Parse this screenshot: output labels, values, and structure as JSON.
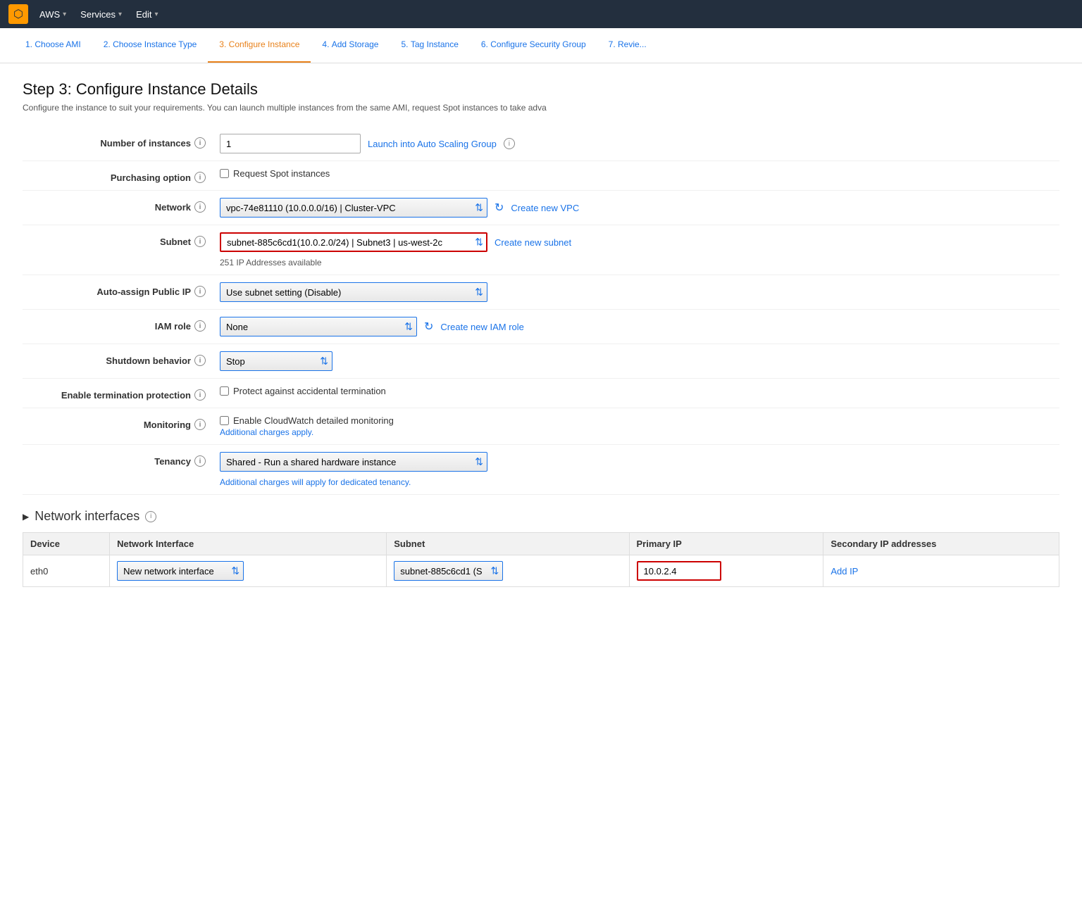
{
  "nav": {
    "logo_label": "AWS",
    "items": [
      {
        "label": "AWS",
        "has_arrow": true
      },
      {
        "label": "Services",
        "has_arrow": true
      },
      {
        "label": "Edit",
        "has_arrow": true
      }
    ]
  },
  "wizard": {
    "tabs": [
      {
        "num": "1.",
        "label": "Choose AMI",
        "active": false
      },
      {
        "num": "2.",
        "label": "Choose Instance Type",
        "active": false
      },
      {
        "num": "3.",
        "label": "Configure Instance",
        "active": true
      },
      {
        "num": "4.",
        "label": "Add Storage",
        "active": false
      },
      {
        "num": "5.",
        "label": "Tag Instance",
        "active": false
      },
      {
        "num": "6.",
        "label": "Configure Security Group",
        "active": false
      },
      {
        "num": "7.",
        "label": "Revie...",
        "active": false
      }
    ]
  },
  "page": {
    "title": "Step 3: Configure Instance Details",
    "description": "Configure the instance to suit your requirements. You can launch multiple instances from the same AMI, request Spot instances to take adva"
  },
  "form": {
    "number_of_instances_label": "Number of instances",
    "number_of_instances_value": "1",
    "launch_scaling_group": "Launch into Auto Scaling Group",
    "purchasing_option_label": "Purchasing option",
    "purchasing_option_checkbox": "Request Spot instances",
    "network_label": "Network",
    "network_value": "vpc-74e81110 (10.0.0.0/16) | Cluster-VPC",
    "create_vpc_link": "Create new VPC",
    "subnet_label": "Subnet",
    "subnet_value": "subnet-885c6cd1(10.0.2.0/24) | Subnet3 | us-west-2c",
    "subnet_ip_available": "251 IP Addresses available",
    "create_subnet_link": "Create new subnet",
    "auto_assign_label": "Auto-assign Public IP",
    "auto_assign_value": "Use subnet setting (Disable)",
    "iam_role_label": "IAM role",
    "iam_role_value": "None",
    "create_iam_link": "Create new IAM role",
    "shutdown_label": "Shutdown behavior",
    "shutdown_value": "Stop",
    "termination_label": "Enable termination protection",
    "termination_checkbox": "Protect against accidental termination",
    "monitoring_label": "Monitoring",
    "monitoring_checkbox": "Enable CloudWatch detailed monitoring",
    "monitoring_note": "Additional charges apply.",
    "tenancy_label": "Tenancy",
    "tenancy_value": "Shared - Run a shared hardware instance",
    "tenancy_note": "Additional charges will apply for dedicated tenancy."
  },
  "network_interfaces": {
    "section_title": "Network interfaces",
    "columns": [
      "Device",
      "Network Interface",
      "Subnet",
      "Primary IP",
      "Secondary IP addresses"
    ],
    "rows": [
      {
        "device": "eth0",
        "network_interface": "New network interface",
        "subnet": "subnet-885c6cd1 (S",
        "primary_ip": "10.0.2.4",
        "secondary_ip_link": "Add IP"
      }
    ]
  }
}
